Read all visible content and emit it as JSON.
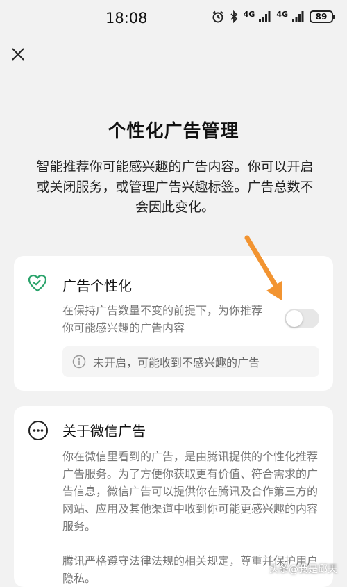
{
  "status_bar": {
    "time": "18:08",
    "network1": "4G",
    "network2": "4G",
    "battery": "89",
    "icons": [
      "alarm-icon",
      "bluetooth-icon",
      "signal-icon",
      "signal-icon",
      "battery-icon"
    ]
  },
  "header": {
    "close_icon": "close-icon"
  },
  "page": {
    "title": "个性化广告管理",
    "description": "智能推荐你可能感兴趣的广告内容。你可以开启或关闭服务，或管理广告兴趣标签。广告总数不会因此变化。"
  },
  "ad_personalization": {
    "icon": "heart-icon",
    "title": "广告个性化",
    "description": "在保持广告数量不变的前提下，为你推荐你可能感兴趣的广告内容",
    "enabled": false,
    "notice": "未开启，可能收到不感兴趣的广告",
    "notice_icon": "info-icon"
  },
  "about": {
    "icon": "more-icon",
    "title": "关于微信广告",
    "paragraph1": "你在微信里看到的广告，是由腾讯提供的个性化推荐广告服务。为了方便你获取更有价值、符合需求的广告信息，微信广告可以提供你在腾讯及合作第三方的网站、应用及其他渠道中收到你可能更感兴趣的内容服务。",
    "paragraph2": "腾讯严格遵守法律法规的相关规定，尊重并保护用户隐私。"
  },
  "annotation": {
    "arrow_color": "#f29431"
  },
  "watermark": "头条@我是邱天",
  "colors": {
    "accent": "#2aa36b",
    "background": "#f2f2f2",
    "card": "#ffffff"
  }
}
